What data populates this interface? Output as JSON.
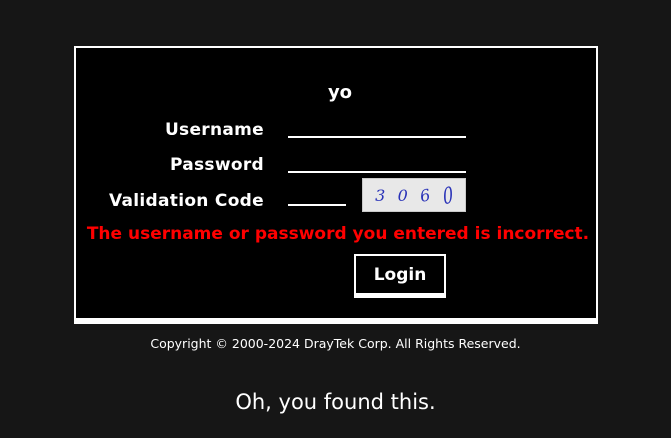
{
  "login_panel": {
    "title": "yo",
    "username_label": "Username",
    "password_label": "Password",
    "validation_label": "Validation Code",
    "username_value": "",
    "password_value": "",
    "validation_value": "",
    "captcha": [
      "3",
      "0",
      "6",
      "0"
    ],
    "error_message": "The username or password you entered is incorrect.",
    "login_button": "Login"
  },
  "footer": {
    "copyright": "Copyright © 2000-2024 DrayTek Corp. All Rights Reserved."
  },
  "easter_egg": "Oh, you found this.",
  "colors": {
    "background": "#161616",
    "panel": "#000000",
    "error": "#ff0000",
    "captcha_text": "#2a33b8"
  }
}
